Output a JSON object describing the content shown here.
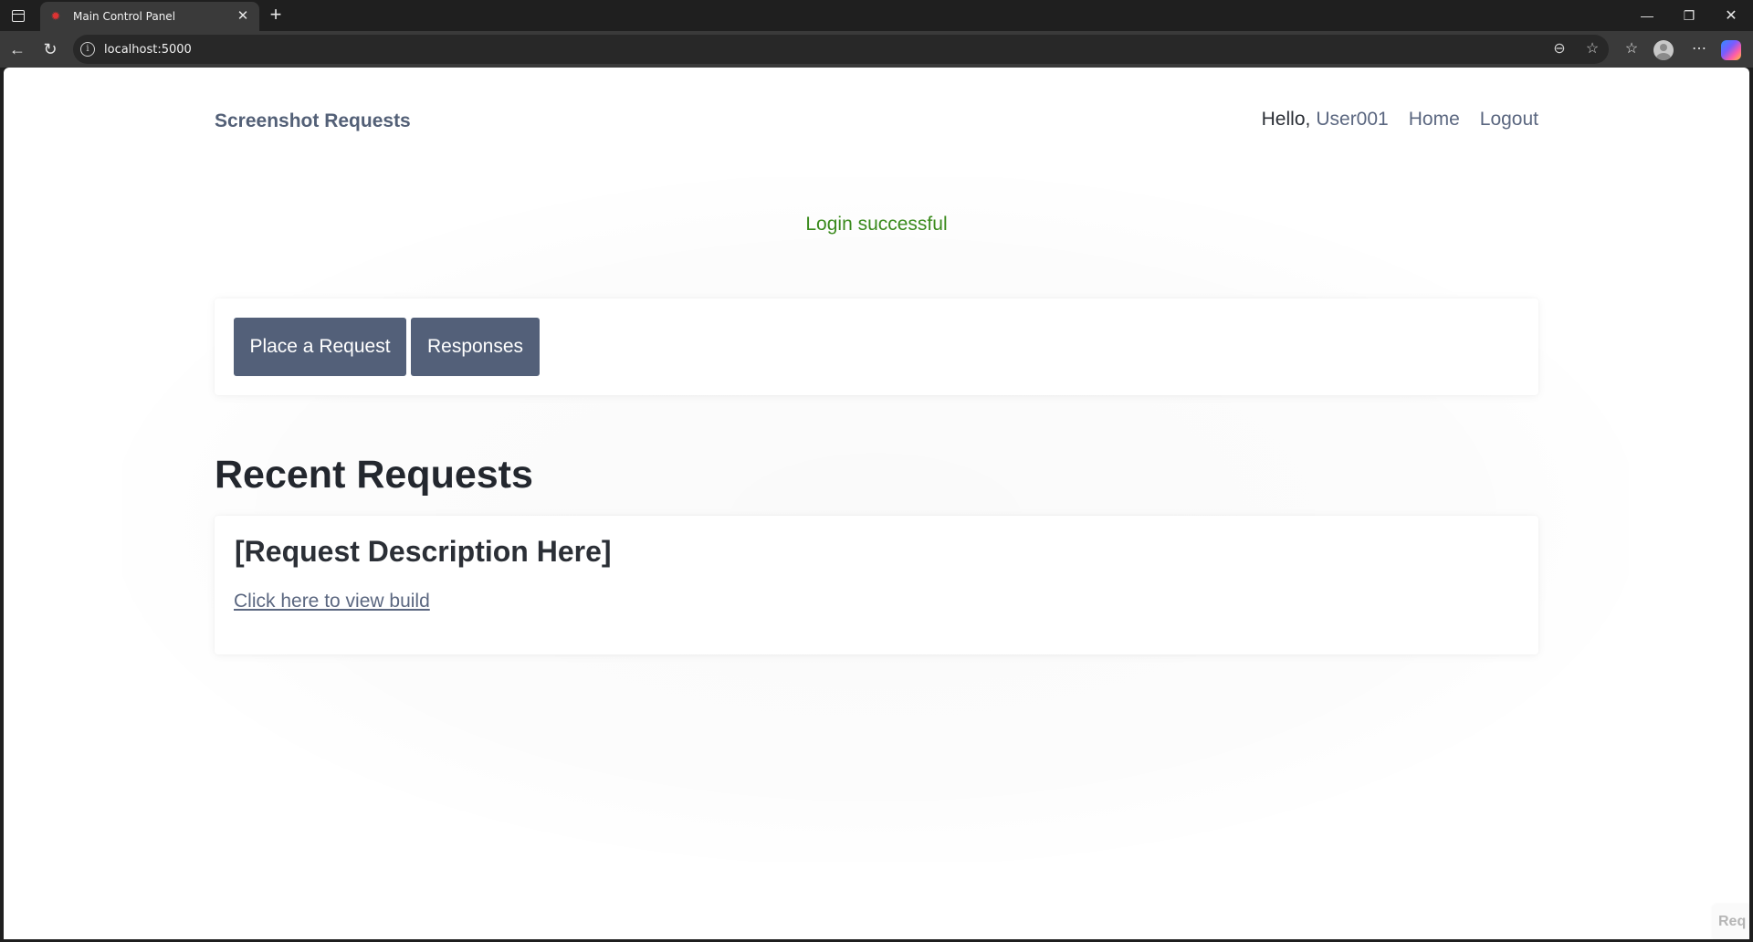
{
  "browser": {
    "tab_title": "Main Control Panel",
    "url": "localhost:5000",
    "icons": {
      "tab_favicon": "gear-icon",
      "close": "close-icon",
      "new_tab": "plus-icon"
    }
  },
  "header": {
    "brand": "Screenshot Requests",
    "greeting": "Hello,",
    "username": "User001",
    "nav": {
      "home": "Home",
      "logout": "Logout"
    }
  },
  "flash_message": "Login successful",
  "actions": {
    "place_request": "Place a Request",
    "responses": "Responses"
  },
  "recent": {
    "title": "Recent Requests",
    "items": [
      {
        "description": "[Request Description Here]",
        "link_text": "Click here to view build"
      }
    ]
  },
  "corner_badge": "Req",
  "colors": {
    "accent": "#536079",
    "link": "#5b6780",
    "success": "#3a8a1c"
  }
}
